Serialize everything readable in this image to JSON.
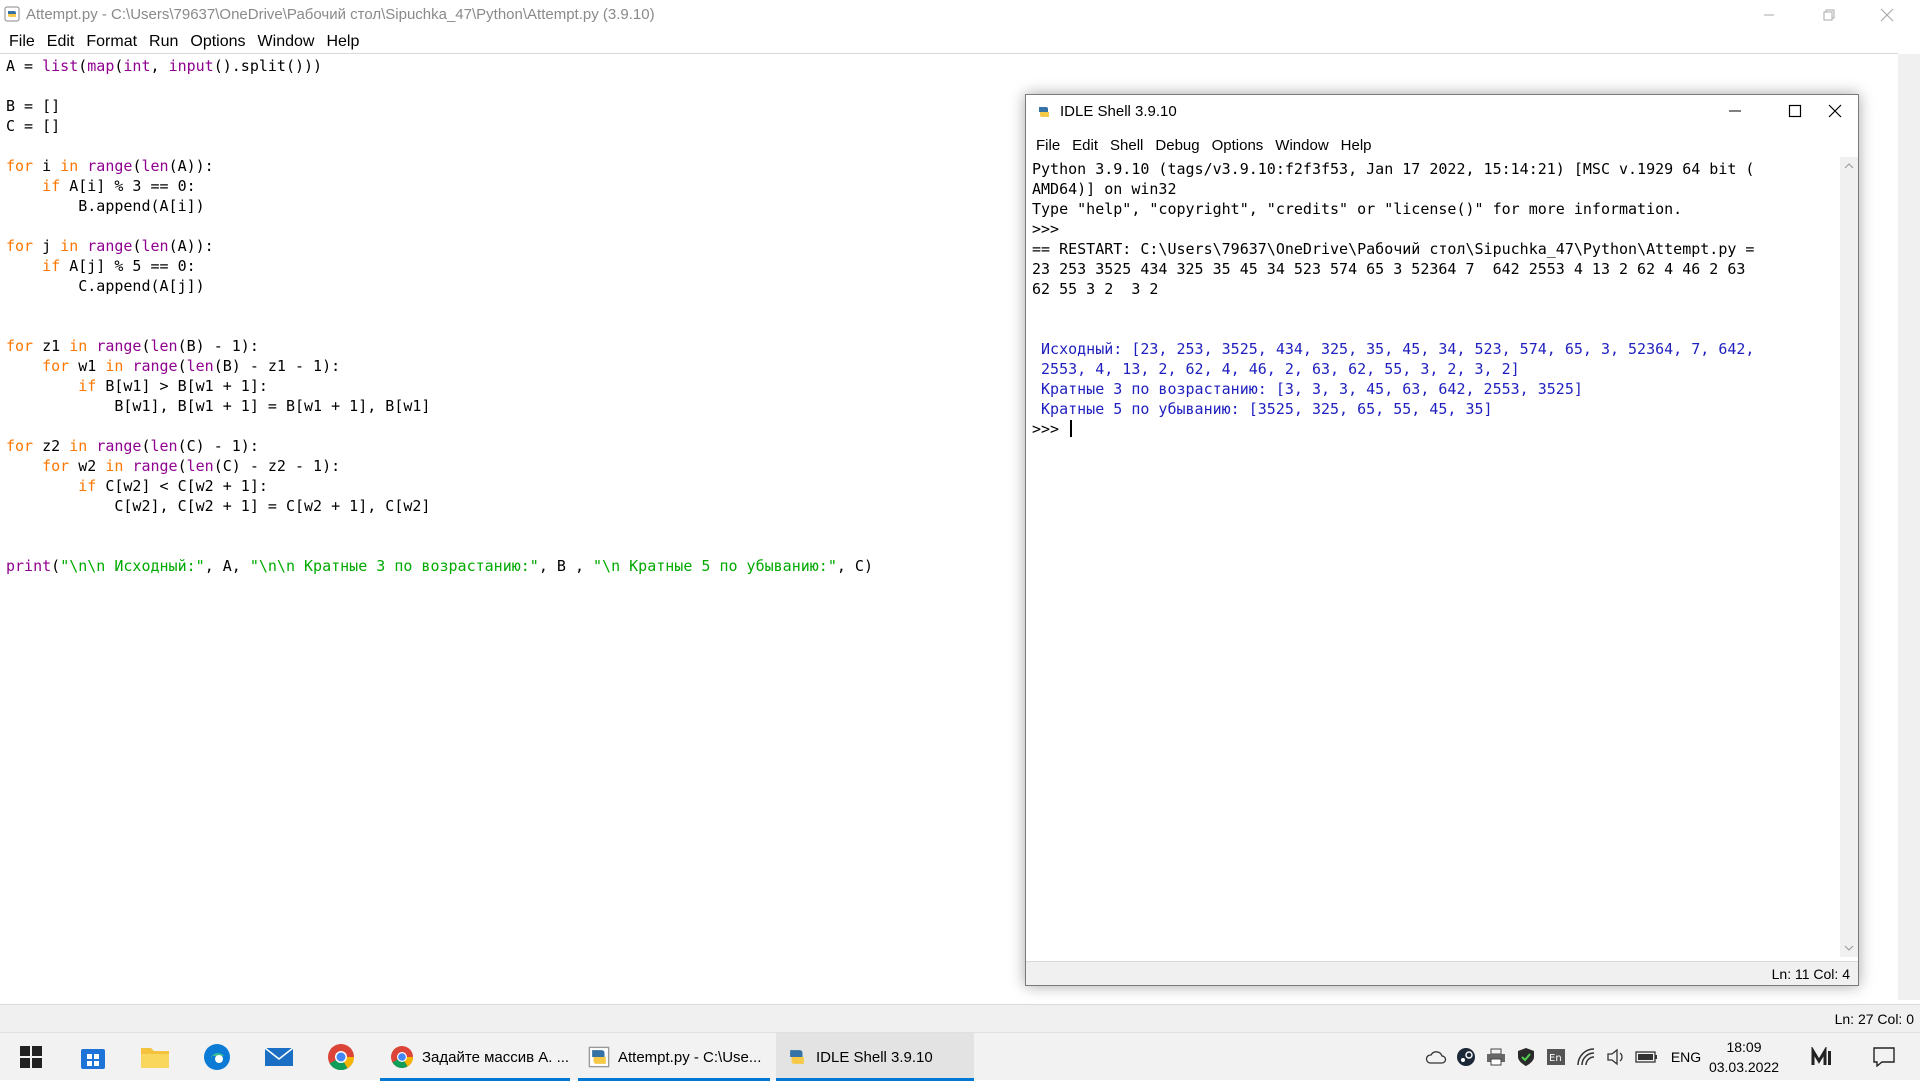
{
  "editor": {
    "title": "Attempt.py - C:\\Users\\79637\\OneDrive\\Рабочий стол\\Sipuchka_47\\Python\\Attempt.py (3.9.10)",
    "menu": [
      "File",
      "Edit",
      "Format",
      "Run",
      "Options",
      "Window",
      "Help"
    ],
    "code": [
      [
        [
          "t",
          "A = "
        ],
        [
          "b",
          "list"
        ],
        [
          "t",
          "("
        ],
        [
          "b",
          "map"
        ],
        [
          "t",
          "("
        ],
        [
          "b",
          "int"
        ],
        [
          "t",
          ", "
        ],
        [
          "b",
          "input"
        ],
        [
          "t",
          "().split()))"
        ]
      ],
      [],
      [
        [
          "t",
          "B = []"
        ]
      ],
      [
        [
          "t",
          "C = []"
        ]
      ],
      [],
      [
        [
          "k",
          "for"
        ],
        [
          "t",
          " i "
        ],
        [
          "k",
          "in"
        ],
        [
          "t",
          " "
        ],
        [
          "b",
          "range"
        ],
        [
          "t",
          "("
        ],
        [
          "b",
          "len"
        ],
        [
          "t",
          "(A)):"
        ]
      ],
      [
        [
          "t",
          "    "
        ],
        [
          "k",
          "if"
        ],
        [
          "t",
          " A[i] % 3 == 0:"
        ]
      ],
      [
        [
          "t",
          "        B.append(A[i])"
        ]
      ],
      [],
      [
        [
          "k",
          "for"
        ],
        [
          "t",
          " j "
        ],
        [
          "k",
          "in"
        ],
        [
          "t",
          " "
        ],
        [
          "b",
          "range"
        ],
        [
          "t",
          "("
        ],
        [
          "b",
          "len"
        ],
        [
          "t",
          "(A)):"
        ]
      ],
      [
        [
          "t",
          "    "
        ],
        [
          "k",
          "if"
        ],
        [
          "t",
          " A[j] % 5 == 0:"
        ]
      ],
      [
        [
          "t",
          "        C.append(A[j])"
        ]
      ],
      [],
      [],
      [
        [
          "k",
          "for"
        ],
        [
          "t",
          " z1 "
        ],
        [
          "k",
          "in"
        ],
        [
          "t",
          " "
        ],
        [
          "b",
          "range"
        ],
        [
          "t",
          "("
        ],
        [
          "b",
          "len"
        ],
        [
          "t",
          "(B) - 1):"
        ]
      ],
      [
        [
          "t",
          "    "
        ],
        [
          "k",
          "for"
        ],
        [
          "t",
          " w1 "
        ],
        [
          "k",
          "in"
        ],
        [
          "t",
          " "
        ],
        [
          "b",
          "range"
        ],
        [
          "t",
          "("
        ],
        [
          "b",
          "len"
        ],
        [
          "t",
          "(B) - z1 - 1):"
        ]
      ],
      [
        [
          "t",
          "        "
        ],
        [
          "k",
          "if"
        ],
        [
          "t",
          " B[w1] > B[w1 + 1]:"
        ]
      ],
      [
        [
          "t",
          "            B[w1], B[w1 + 1] = B[w1 + 1], B[w1]"
        ]
      ],
      [],
      [
        [
          "k",
          "for"
        ],
        [
          "t",
          " z2 "
        ],
        [
          "k",
          "in"
        ],
        [
          "t",
          " "
        ],
        [
          "b",
          "range"
        ],
        [
          "t",
          "("
        ],
        [
          "b",
          "len"
        ],
        [
          "t",
          "(C) - 1):"
        ]
      ],
      [
        [
          "t",
          "    "
        ],
        [
          "k",
          "for"
        ],
        [
          "t",
          " w2 "
        ],
        [
          "k",
          "in"
        ],
        [
          "t",
          " "
        ],
        [
          "b",
          "range"
        ],
        [
          "t",
          "("
        ],
        [
          "b",
          "len"
        ],
        [
          "t",
          "(C) - z2 - 1):"
        ]
      ],
      [
        [
          "t",
          "        "
        ],
        [
          "k",
          "if"
        ],
        [
          "t",
          " C[w2] < C[w2 + 1]:"
        ]
      ],
      [
        [
          "t",
          "            C[w2], C[w2 + 1] = C[w2 + 1], C[w2]"
        ]
      ],
      [],
      [],
      [
        [
          "b",
          "print"
        ],
        [
          "t",
          "("
        ],
        [
          "s",
          "\"\\n\\n Исходный:\""
        ],
        [
          "t",
          ", A, "
        ],
        [
          "s",
          "\"\\n\\n Кратные 3 по возрастанию:\""
        ],
        [
          "t",
          ", B , "
        ],
        [
          "s",
          "\"\\n Кратные 5 по убыванию:\""
        ],
        [
          "t",
          ", C)"
        ]
      ]
    ],
    "status": "Ln: 27  Col: 0"
  },
  "shell": {
    "title": "IDLE Shell 3.9.10",
    "menu": [
      "File",
      "Edit",
      "Shell",
      "Debug",
      "Options",
      "Window",
      "Help"
    ],
    "lines": [
      [
        "t",
        "Python 3.9.10 (tags/v3.9.10:f2f3f53, Jan 17 2022, 15:14:21) [MSC v.1929 64 bit ("
      ],
      [
        "t",
        "AMD64)] on win32"
      ],
      [
        "t",
        "Type \"help\", \"copyright\", \"credits\" or \"license()\" for more information."
      ],
      [
        "t",
        ">>> "
      ],
      [
        "t",
        "== RESTART: C:\\Users\\79637\\OneDrive\\Рабочий стол\\Sipuchka_47\\Python\\Attempt.py ="
      ],
      [
        "t",
        "23 253 3525 434 325 35 45 34 523 574 65 3 52364 7  642 2553 4 13 2 62 4 46 2 63"
      ],
      [
        "t",
        "62 55 3 2  3 2"
      ],
      [
        "t",
        ""
      ],
      [
        "t",
        ""
      ],
      [
        "o",
        " Исходный: [23, 253, 3525, 434, 325, 35, 45, 34, 523, 574, 65, 3, 52364, 7, 642,"
      ],
      [
        "o",
        " 2553, 4, 13, 2, 62, 4, 46, 2, 63, 62, 55, 3, 2, 3, 2]"
      ],
      [
        "o",
        " Кратные 3 по возрастанию: [3, 3, 3, 45, 63, 642, 2553, 3525]"
      ],
      [
        "o",
        " Кратные 5 по убыванию: [3525, 325, 65, 55, 45, 35]"
      ]
    ],
    "prompt": ">>> ",
    "status": "Ln: 11   Col: 4"
  },
  "taskbar": {
    "apps": [
      {
        "label": "Задайте массив А. ...",
        "icon": "chrome-icon"
      },
      {
        "label": "Attempt.py - C:\\Use...",
        "icon": "python-icon"
      },
      {
        "label": "IDLE Shell 3.9.10",
        "icon": "python-icon"
      }
    ],
    "language": "ENG",
    "time": "18:09",
    "date": "03.03.2022"
  },
  "colors": {
    "keyword": "#ff7700",
    "builtin": "#900090",
    "string": "#00aa00",
    "output": "#1f1fbf",
    "taskbar_accent": "#0078d4"
  }
}
